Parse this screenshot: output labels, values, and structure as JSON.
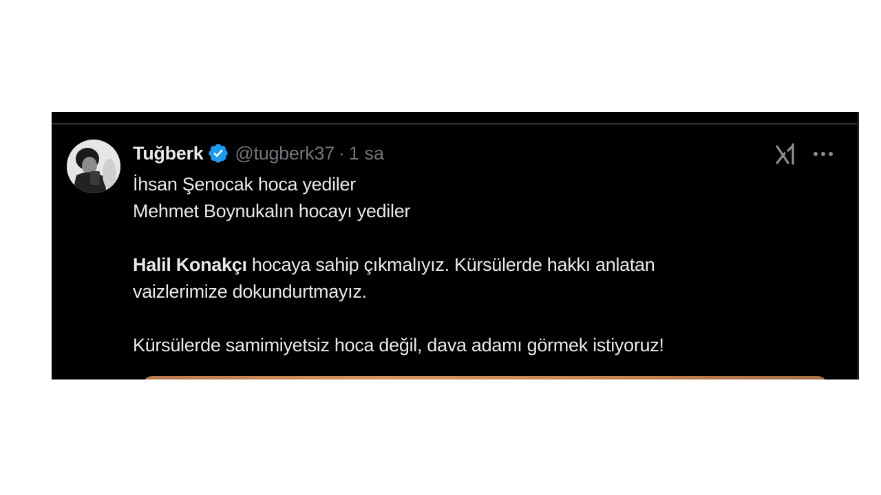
{
  "tweet": {
    "author": {
      "display_name": "Tuğberk",
      "verified": true,
      "handle": "@tugberk37",
      "separator": "·",
      "time": "1 sa"
    },
    "body": {
      "line1": "İhsan Şenocak hoca yediler",
      "line2": "Mehmet Boynukalın hocayı yediler",
      "para2_bold": "Halil Konakçı",
      "para2_rest_line1": " hocaya sahip çıkmalıyız. Kürsülerde hakkı anlatan",
      "para2_line2": "vaizlerimize dokundurtmayız.",
      "para3": "Kürsülerde samimiyetsiz hoca değil, dava adamı görmek istiyoruz!"
    },
    "icons": {
      "verified": "verified-badge-icon",
      "grok": "grok-icon",
      "more": "more-options-icon"
    }
  },
  "colors": {
    "background": "#000000",
    "text_primary": "#e7e9ea",
    "text_secondary": "#71767b",
    "verified_blue": "#1d9bf0"
  }
}
